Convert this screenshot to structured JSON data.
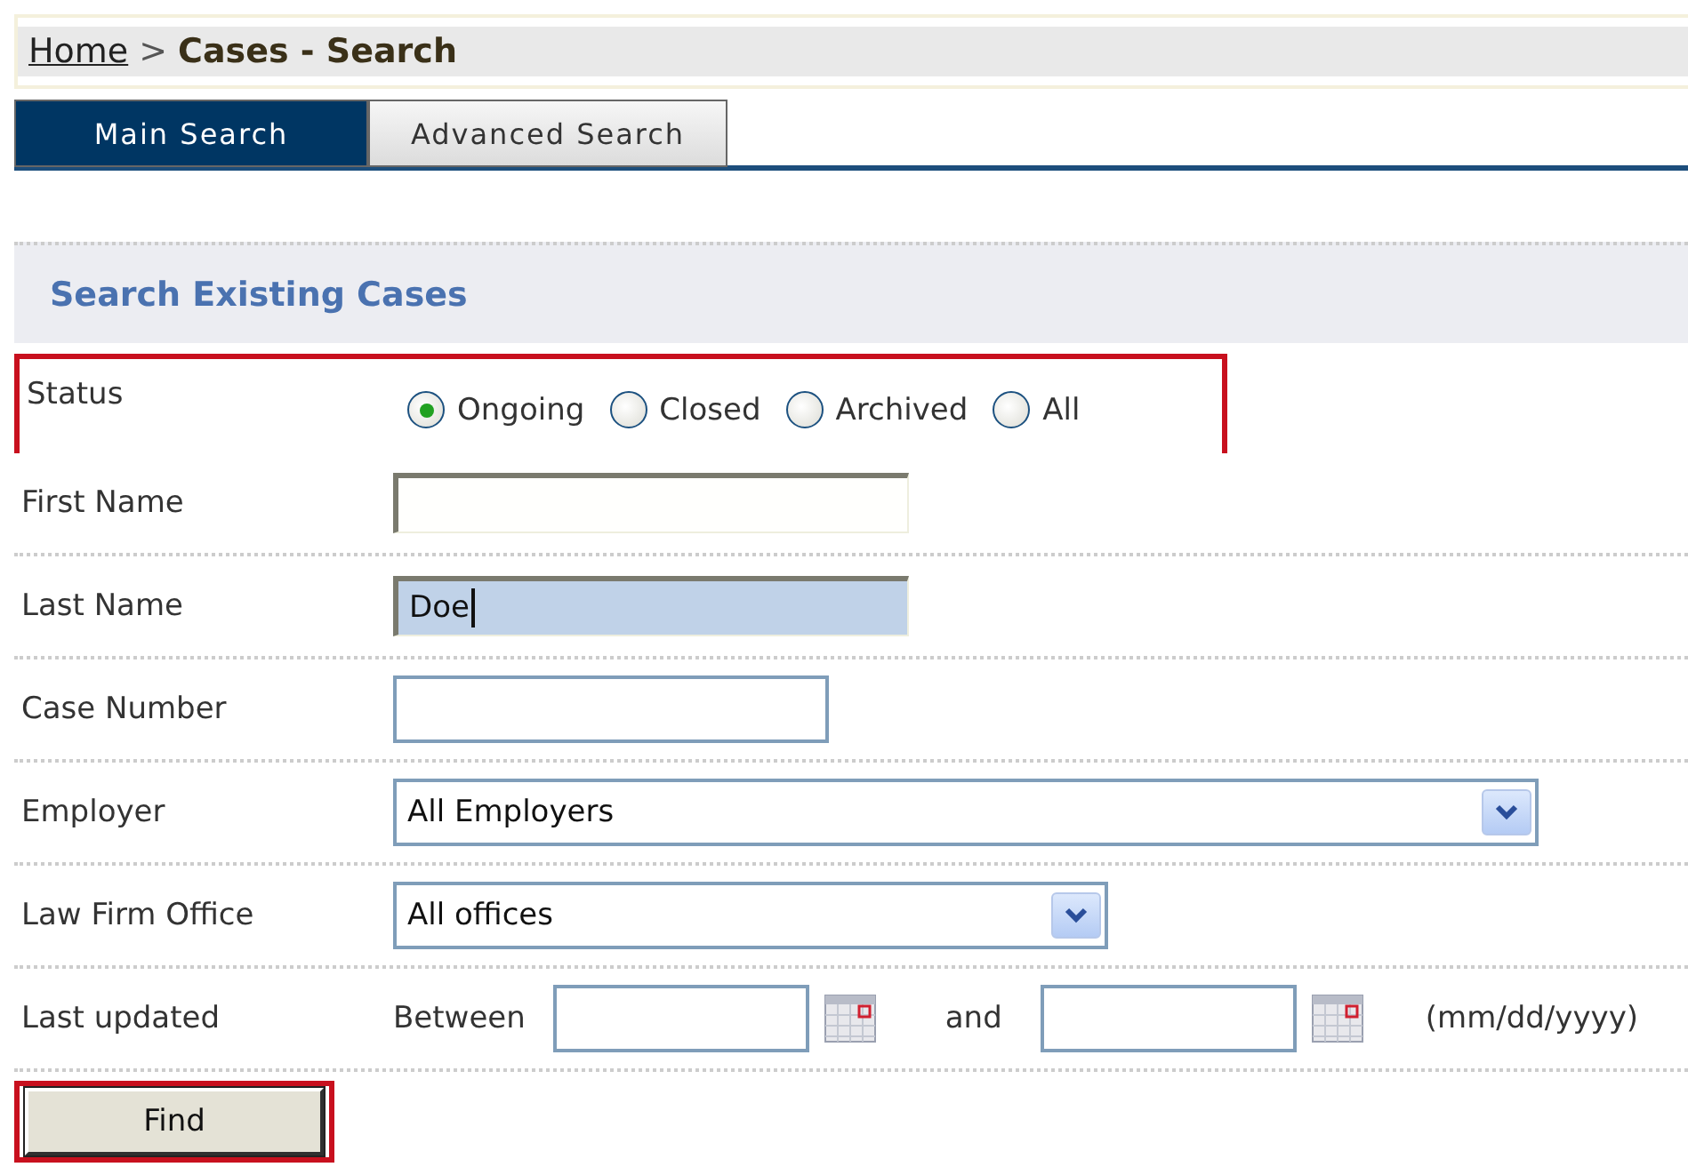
{
  "breadcrumb": {
    "link": "Home",
    "separator": ">",
    "current": "Cases - Search"
  },
  "tabs": [
    {
      "label": "Main Search",
      "selected": true
    },
    {
      "label": "Advanced Search",
      "selected": false
    }
  ],
  "section_title": "Search Existing Cases",
  "fields": [
    {
      "kind": "radio",
      "label": "Status",
      "highlighted": true,
      "options": [
        {
          "label": "Ongoing",
          "selected": true
        },
        {
          "label": "Closed",
          "selected": false
        },
        {
          "label": "Archived",
          "selected": false
        },
        {
          "label": "All",
          "selected": false
        }
      ]
    },
    {
      "kind": "text",
      "label": "First Name",
      "focused": false
    },
    {
      "kind": "text",
      "label": "Last Name",
      "value": "Doe",
      "focused": true
    },
    {
      "kind": "text",
      "label": "Case Number",
      "focused": false
    },
    {
      "kind": "select",
      "label": "Employer",
      "value": "All Employers"
    },
    {
      "kind": "select",
      "label": "Law Firm Office",
      "value": "All offices"
    },
    {
      "kind": "date_range",
      "label": "Last updated",
      "prefix": "Between",
      "middle": "and",
      "hint": "(mm/dd/yyyy)"
    }
  ],
  "find_button": {
    "label": "Find",
    "highlighted": true
  }
}
